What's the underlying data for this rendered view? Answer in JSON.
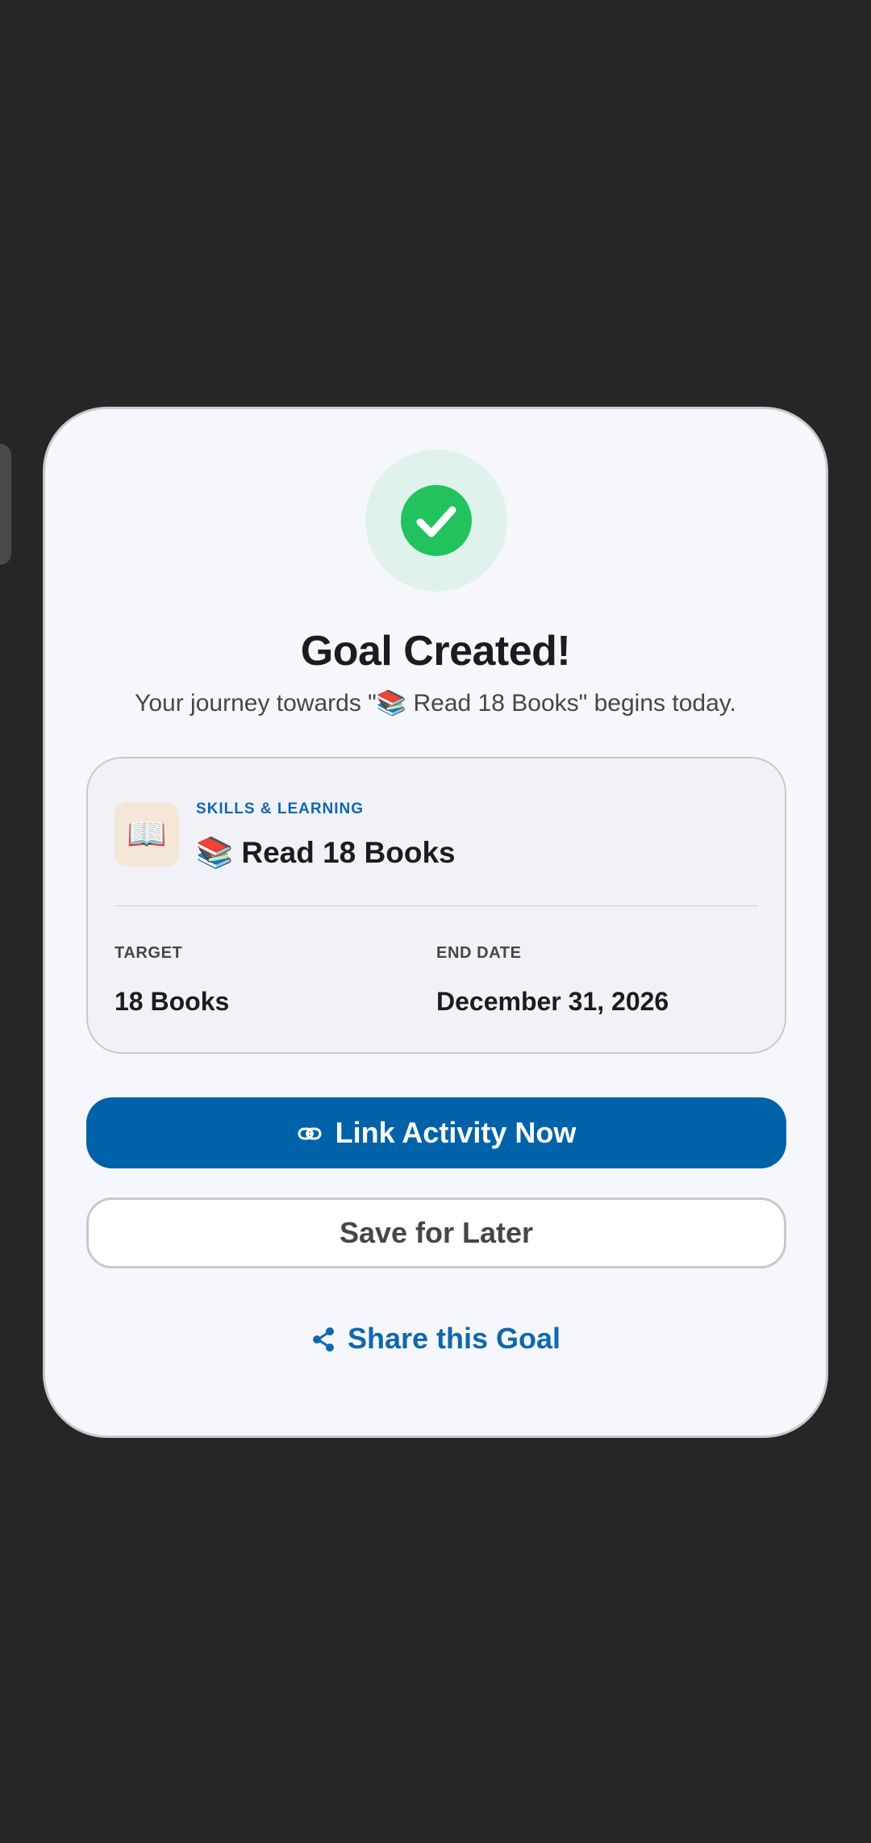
{
  "dialog": {
    "title": "Goal Created!",
    "subtitle": "Your journey towards \"📚 Read 18 Books\" begins today."
  },
  "goal_card": {
    "category_icon": "open-book-icon",
    "category_icon_glyph": "📖",
    "category": "SKILLS & LEARNING",
    "name": "📚 Read 18 Books",
    "target_label": "TARGET",
    "target_value": "18 Books",
    "end_date_label": "END DATE",
    "end_date_value": "December 31, 2026"
  },
  "actions": {
    "link_activity_label": "Link Activity Now",
    "save_later_label": "Save for Later",
    "share_label": "Share this Goal"
  },
  "colors": {
    "accent": "#0062a9",
    "success": "#22c35e",
    "background": "#262626",
    "card": "#f6f7fc"
  }
}
